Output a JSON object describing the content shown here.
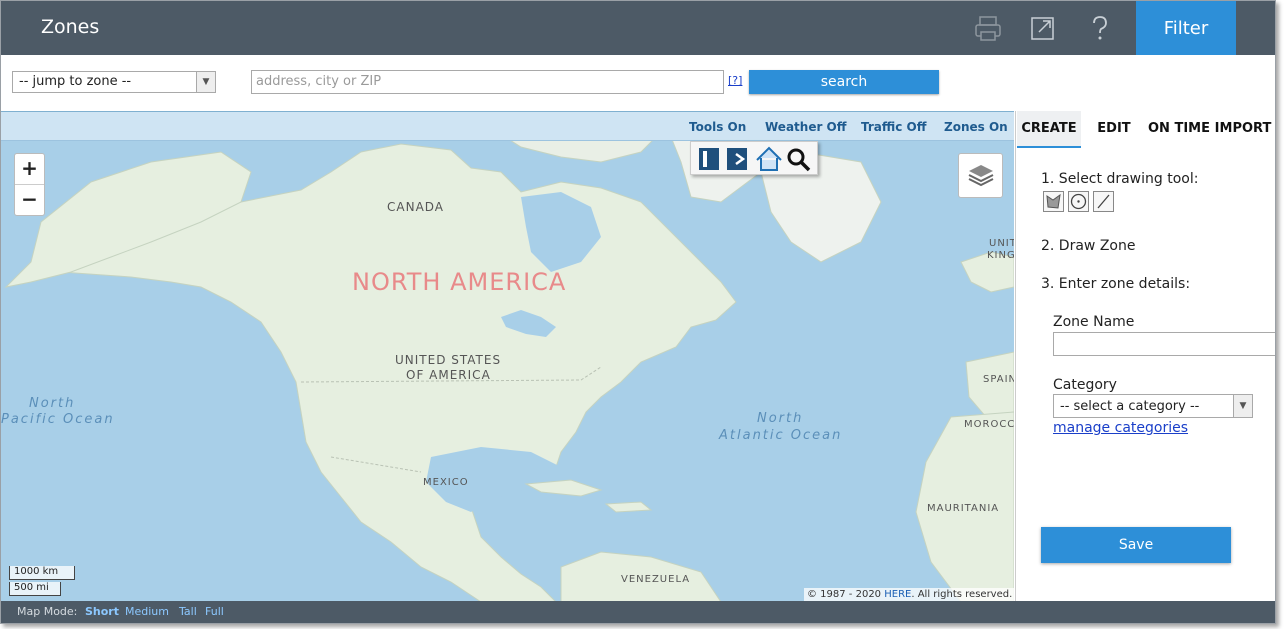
{
  "header": {
    "title": "Zones",
    "icons": [
      "print-icon",
      "export-icon",
      "help-icon"
    ],
    "filter_label": "Filter"
  },
  "search": {
    "zone_select_value": "-- jump to zone --",
    "address_placeholder": "address, city or ZIP",
    "help_link": "[?]",
    "search_label": "search"
  },
  "map": {
    "toggles": [
      "Tools On",
      "Weather Off",
      "Traffic Off",
      "Zones On"
    ],
    "zoom_in": "+",
    "zoom_out": "−",
    "labels": {
      "canada": "CANADA",
      "north_america": "NORTH AMERICA",
      "usa_line1": "UNITED STATES",
      "usa_line2": "OF AMERICA",
      "mexico": "MEXICO",
      "venezuela": "VENEZUELA",
      "spain": "SPAIN",
      "morocco": "MOROCCO",
      "mauritania": "MAURITANIA",
      "uk_line1": "UNIT",
      "uk_line2": "KING"
    },
    "oceans": {
      "pacific_line1": "North",
      "pacific_line2": "Pacific Ocean",
      "atlantic_line1": "North",
      "atlantic_line2": "Atlantic Ocean"
    },
    "scale": {
      "km": "1000 km",
      "mi": "500 mi"
    },
    "copyright_prefix": "© 1987 - 2020",
    "copyright_link": "HERE",
    "copyright_suffix": ". All rights reserved."
  },
  "map_mode": {
    "label": "Map Mode:",
    "options": [
      "Short",
      "Medium",
      "Tall",
      "Full"
    ],
    "active": "Short"
  },
  "panel": {
    "tabs": [
      "CREATE",
      "EDIT",
      "ON TIME",
      "IMPORT"
    ],
    "active_tab": "CREATE",
    "step1": "1. Select drawing tool:",
    "step2": "2. Draw Zone",
    "step3": "3. Enter zone details:",
    "zone_name_label": "Zone Name",
    "zone_name_value": "",
    "category_label": "Category",
    "category_value": "-- select a category --",
    "manage_link": "manage categories",
    "save_label": "Save"
  },
  "colors": {
    "header_bg": "#4d5a66",
    "accent": "#2d8fd8",
    "ocean": "#a8cfe8",
    "land": "#e6efe0"
  }
}
